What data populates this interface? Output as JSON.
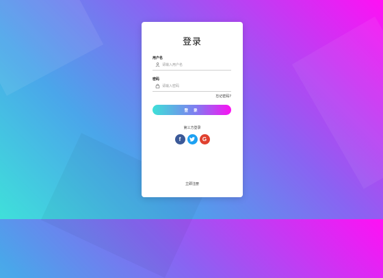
{
  "login": {
    "title": "登录",
    "username": {
      "label": "用户名",
      "placeholder": "请输入用户名",
      "value": ""
    },
    "password": {
      "label": "密码",
      "placeholder": "请输入密码",
      "value": ""
    },
    "forgot_label": "忘记密码?",
    "submit_label": "登 录",
    "third_party_label": "第三方登录",
    "social": [
      {
        "name": "facebook",
        "glyph": "f",
        "color": "#3b5998"
      },
      {
        "name": "twitter",
        "glyph": "t",
        "color": "#1da1f2"
      },
      {
        "name": "google",
        "glyph": "G",
        "color": "#e0412f"
      }
    ],
    "signup_label": "立即注册"
  },
  "theme": {
    "gradient_start": "#3fe0da",
    "gradient_mid": "#8a63f2",
    "gradient_end": "#ff10f4"
  }
}
